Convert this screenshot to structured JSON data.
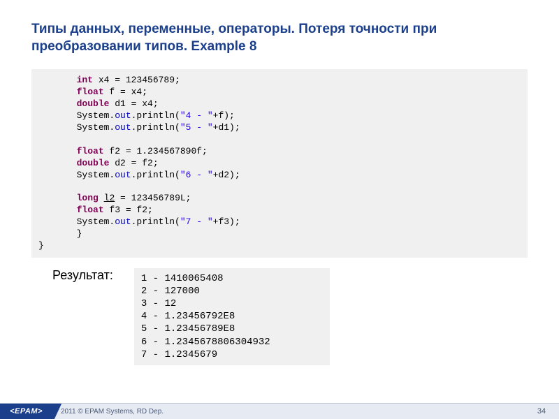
{
  "title": "Типы данных, переменные, операторы. Потеря точности при преобразовании типов. Example 8",
  "code": {
    "l1": {
      "kw": "int",
      "rest": " x4 = 123456789;"
    },
    "l2": {
      "kw": "float",
      "rest": " f = x4;"
    },
    "l3": {
      "kw": "double",
      "rest": " d1 = x4;"
    },
    "l4a": "System.",
    "l4b": "out",
    "l4c": ".println(",
    "l4d": "\"4 - \"",
    "l4e": "+f);",
    "l5a": "System.",
    "l5b": "out",
    "l5c": ".println(",
    "l5d": "\"5 - \"",
    "l5e": "+d1);",
    "l6": {
      "kw": "float",
      "rest": " f2 = 1.234567890f;"
    },
    "l7": {
      "kw": "double",
      "rest": " d2 = f2;"
    },
    "l8a": "System.",
    "l8b": "out",
    "l8c": ".println(",
    "l8d": "\"6 - \"",
    "l8e": "+d2);",
    "l9": {
      "kw": "long",
      "var": "l2",
      "rest": " = 123456789L;"
    },
    "l10": {
      "kw": "float",
      "rest": " f3 = f2;"
    },
    "l11a": "System.",
    "l11b": "out",
    "l11c": ".println(",
    "l11d": "\"7 - \"",
    "l11e": "+f3);",
    "l12": "       }",
    "l13": "}"
  },
  "result_label": "Результат:",
  "result": "1 - 1410065408\n2 - 127000\n3 - 12\n4 - 1.23456792E8\n5 - 1.23456789E8\n6 - 1.2345678806304932\n7 - 1.2345679",
  "footer": {
    "logo": "<EPAM>",
    "copyright": "2011 © EPAM Systems, RD Dep.",
    "page": "34"
  }
}
